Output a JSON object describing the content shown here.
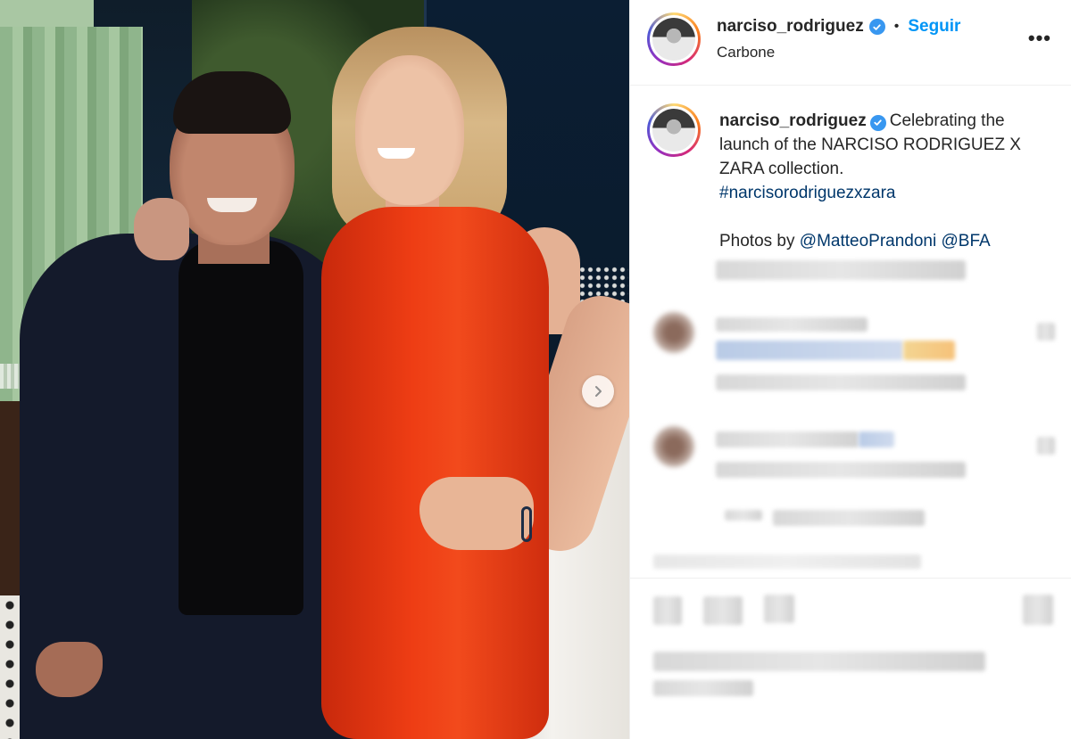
{
  "post": {
    "username": "narciso_rodriguez",
    "follow_label": "Seguir",
    "separator": "•",
    "location": "Carbone",
    "more_label": "•••"
  },
  "caption": {
    "username": "narciso_rodriguez",
    "text": "Celebrating the launch of the NARCISO RODRIGUEZ X ZARA collection.",
    "hashtag": "#narcisorodriguezxzara",
    "credits_prefix": "Photos by",
    "mention_1": "@MatteoPrandoni",
    "mention_2": "@BFA"
  },
  "colors": {
    "link_blue": "#0095f6",
    "mention_blue": "#00376b",
    "verified_blue": "#3897f0",
    "dress_red": "#ee3d14"
  },
  "icons": [
    "verified-badge-icon",
    "more-options-icon",
    "chevron-right-icon"
  ]
}
